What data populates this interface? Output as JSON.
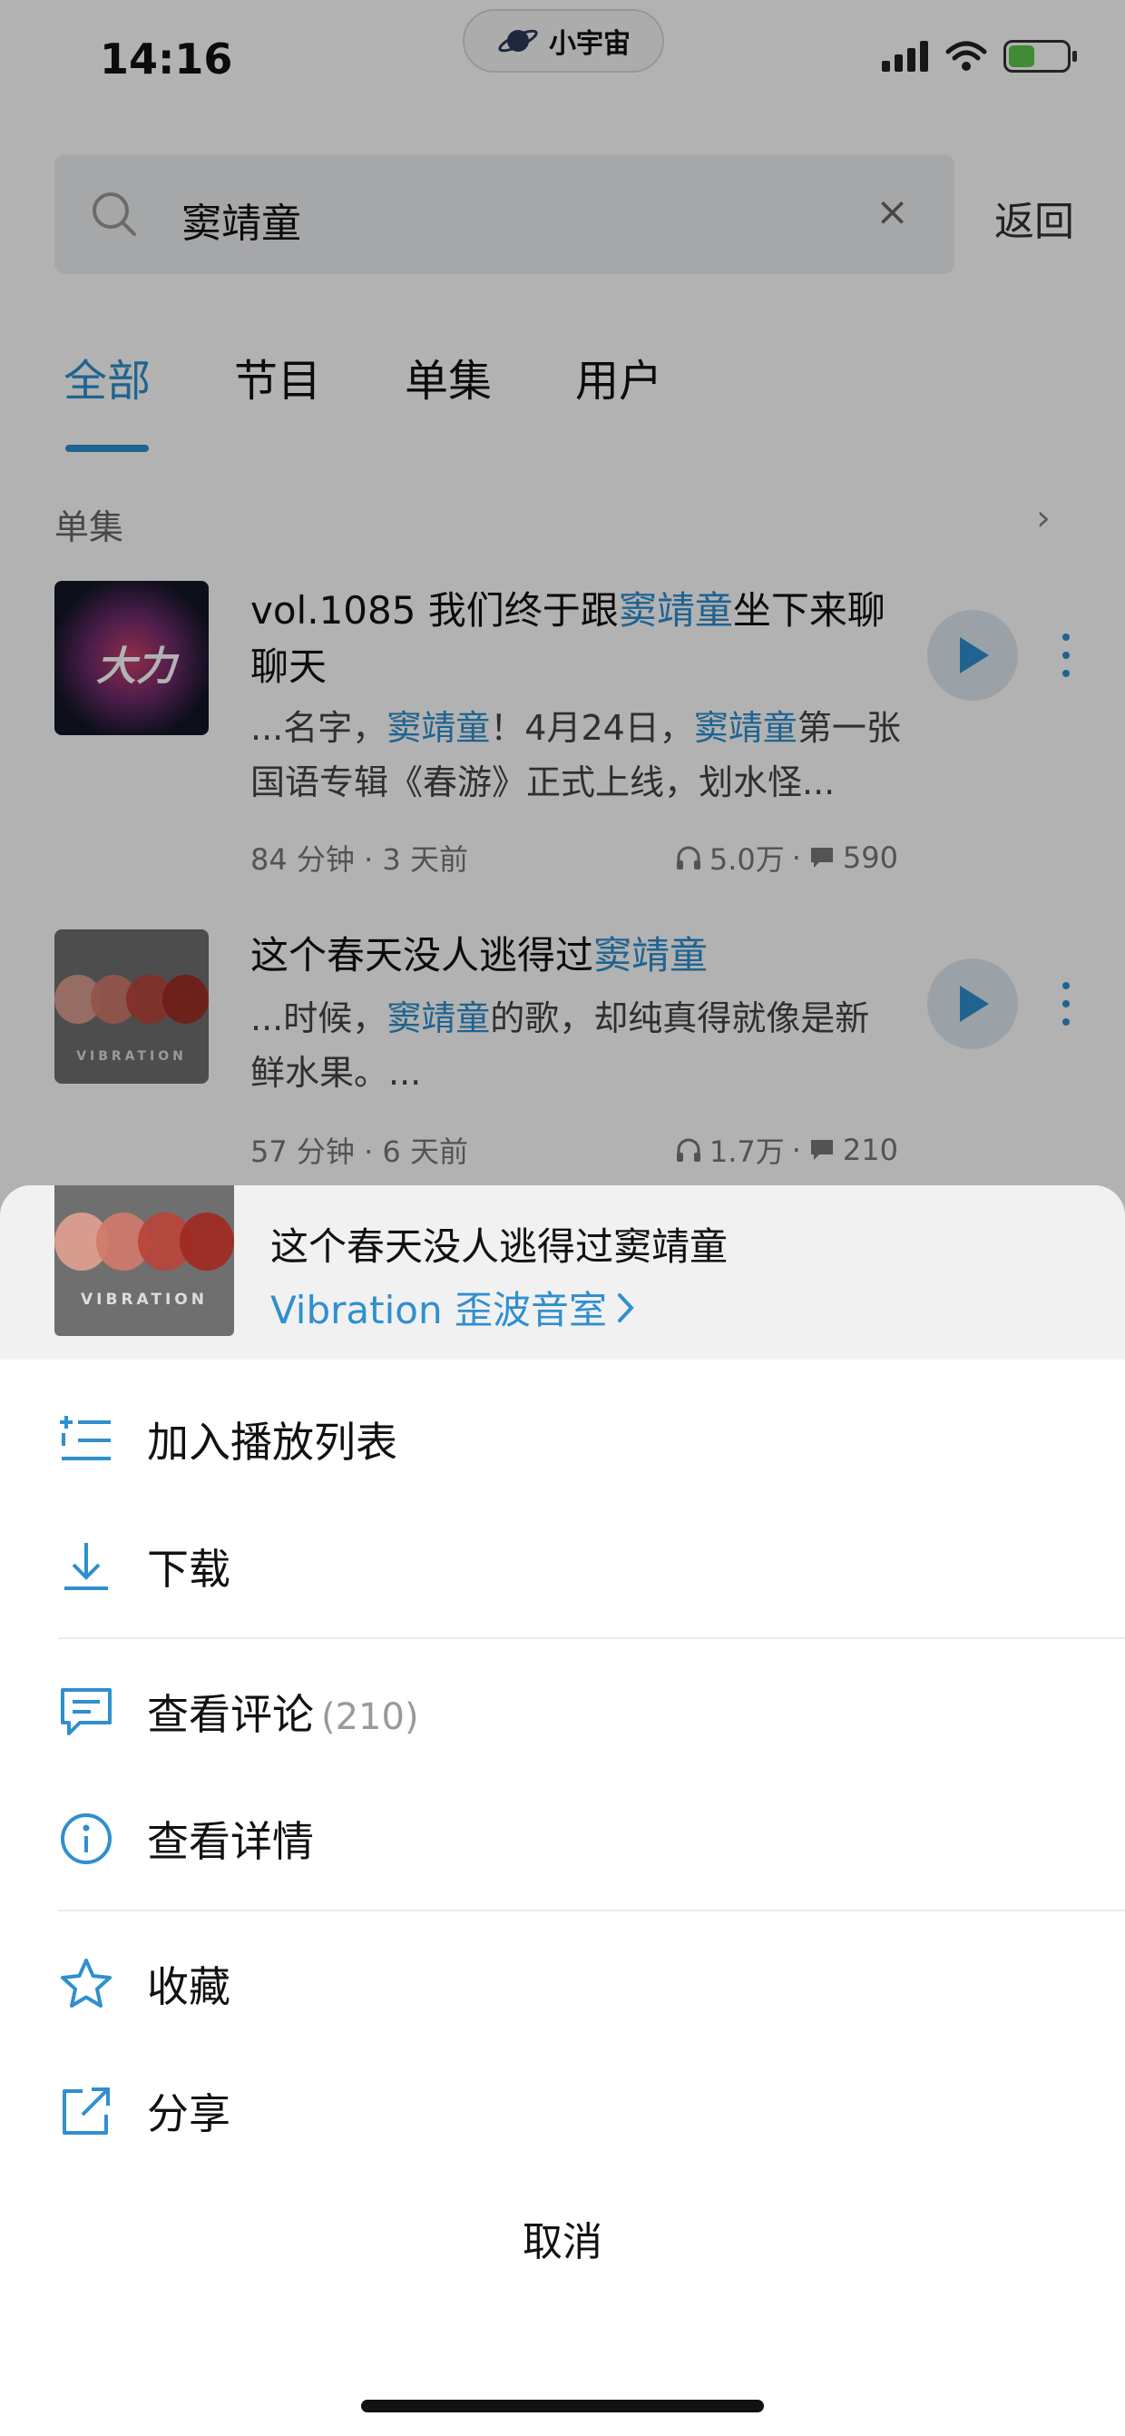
{
  "status_bar": {
    "time": "14:16",
    "brand": "小宇宙"
  },
  "search": {
    "query": "窦靖童",
    "clear": "×",
    "back": "返回"
  },
  "tabs": [
    {
      "label": "全部"
    },
    {
      "label": "节目"
    },
    {
      "label": "单集"
    },
    {
      "label": "用户"
    }
  ],
  "section": {
    "title": "单集"
  },
  "episodes": [
    {
      "title_pre": "vol.1085 我们终于跟",
      "title_hl": "窦靖童",
      "title_post": "坐下来聊聊天",
      "snippet_a": "...名字，",
      "snippet_hl1": "窦靖童",
      "snippet_b": "！4月24日，",
      "snippet_hl2": "窦靖童",
      "snippet_c": "第一张国语专辑《春游》正式上线，划水怪...",
      "duration": "84 分钟 · 3 天前",
      "plays": "5.0万",
      "comments": "590",
      "cover_text": "大力"
    },
    {
      "title_pre": "这个春天没人逃得过",
      "title_hl": "窦靖童",
      "snippet_a": "...时候，",
      "snippet_hl1": "窦靖童",
      "snippet_b": "的歌，却纯真得就像是新鲜水果。...",
      "duration": "57 分钟 · 6 天前",
      "plays": "1.7万",
      "comments": "210",
      "cover_text": "VIBRATION"
    }
  ],
  "sheet": {
    "title": "这个春天没人逃得过窦靖童",
    "channel": "Vibration 歪波音室",
    "cover_text": "VIBRATION",
    "actions": [
      {
        "label": "加入播放列表",
        "icon": "add-to-playlist-icon"
      },
      {
        "label": "下载",
        "icon": "download-icon"
      },
      {
        "label": "查看评论",
        "count": "(210)",
        "icon": "comment-icon"
      },
      {
        "label": "查看详情",
        "icon": "info-icon"
      },
      {
        "label": "收藏",
        "icon": "star-icon"
      },
      {
        "label": "分享",
        "icon": "share-icon"
      }
    ],
    "cancel": "取消"
  },
  "colors": {
    "accent": "#2f8fcf",
    "dim": "rgba(0,0,0,0.30)"
  }
}
